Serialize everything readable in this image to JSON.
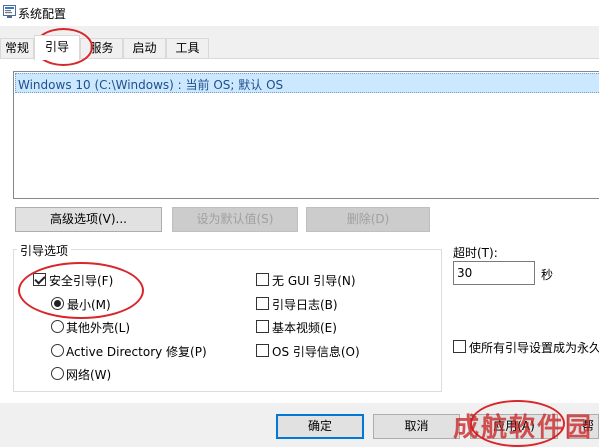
{
  "window": {
    "title": "系统配置",
    "icon": "msconfig-icon"
  },
  "tabs": [
    {
      "label": "常规",
      "active": false
    },
    {
      "label": "引导",
      "active": true
    },
    {
      "label": "服务",
      "active": false
    },
    {
      "label": "启动",
      "active": false
    },
    {
      "label": "工具",
      "active": false
    }
  ],
  "os_list": {
    "entries": [
      "Windows 10 (C:\\Windows) : 当前 OS; 默认 OS"
    ],
    "selected_index": 0
  },
  "buttons": {
    "advanced": "高级选项(V)...",
    "set_default": "设为默认值(S)",
    "delete": "删除(D)"
  },
  "boot_options": {
    "group_title": "引导选项",
    "safe_boot": {
      "label": "安全引导(F)",
      "checked": true
    },
    "minimal": {
      "label": "最小(M)",
      "checked": true
    },
    "alternate_shell": {
      "label": "其他外壳(L)",
      "checked": false
    },
    "active_directory": {
      "label": "Active Directory 修复(P)",
      "checked": false
    },
    "network": {
      "label": "网络(W)",
      "checked": false
    },
    "no_gui": {
      "label": "无 GUI 引导(N)",
      "checked": false
    },
    "boot_log": {
      "label": "引导日志(B)",
      "checked": false
    },
    "base_video": {
      "label": "基本视频(E)",
      "checked": false
    },
    "os_boot_info": {
      "label": "OS 引导信息(O)",
      "checked": false
    }
  },
  "timeout": {
    "label": "超时(T):",
    "value": "30",
    "unit": "秒"
  },
  "permanent": {
    "label": "使所有引导设置成为永久",
    "checked": false
  },
  "dialog_buttons": {
    "ok": "确定",
    "cancel": "取消",
    "apply": "应用(A)",
    "help": "帮"
  },
  "watermark": "成航软件园",
  "colors": {
    "selection_bg": "#cce8ff",
    "annotation": "#d9262b",
    "accent": "#0078d7"
  }
}
